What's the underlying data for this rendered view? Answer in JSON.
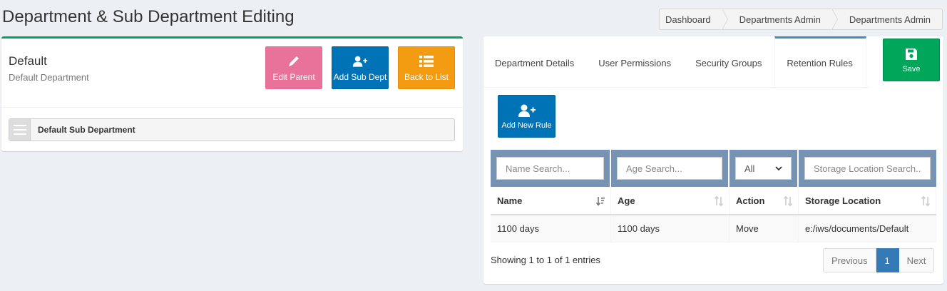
{
  "page": {
    "title": "Department & Sub Department Editing"
  },
  "breadcrumb": [
    "Dashboard",
    "Departments Admin",
    "Departments Admin"
  ],
  "department": {
    "name": "Default",
    "description": "Default Department"
  },
  "buttons": {
    "edit_parent": "Edit Parent",
    "add_sub_dept": "Add Sub Dept",
    "back_to_list": "Back to List",
    "save": "Save",
    "add_new_rule": "Add New Rule"
  },
  "sub_departments": [
    "Default Sub Department"
  ],
  "tabs": [
    {
      "label": "Department Details"
    },
    {
      "label": "User Permissions"
    },
    {
      "label": "Security Groups"
    },
    {
      "label": "Retention Rules",
      "active": true
    }
  ],
  "filters": {
    "name_placeholder": "Name Search...",
    "age_placeholder": "Age Search...",
    "action_value": "All",
    "storage_placeholder": "Storage Location Search..."
  },
  "table": {
    "headers": [
      "Name",
      "Age",
      "Action",
      "Storage Location"
    ],
    "rows": [
      [
        "1100 days",
        "1100 days",
        "Move",
        "e:/iws/documents/Default"
      ]
    ]
  },
  "info": "Showing 1 to 1 of 1 entries",
  "pagination": {
    "previous": "Previous",
    "current": "1",
    "next": "Next"
  },
  "colors": {
    "green": "#00a65a",
    "blue": "#0073b7",
    "pink": "#e9729a",
    "orange": "#f39c12",
    "filter_bg": "#7793b4"
  }
}
